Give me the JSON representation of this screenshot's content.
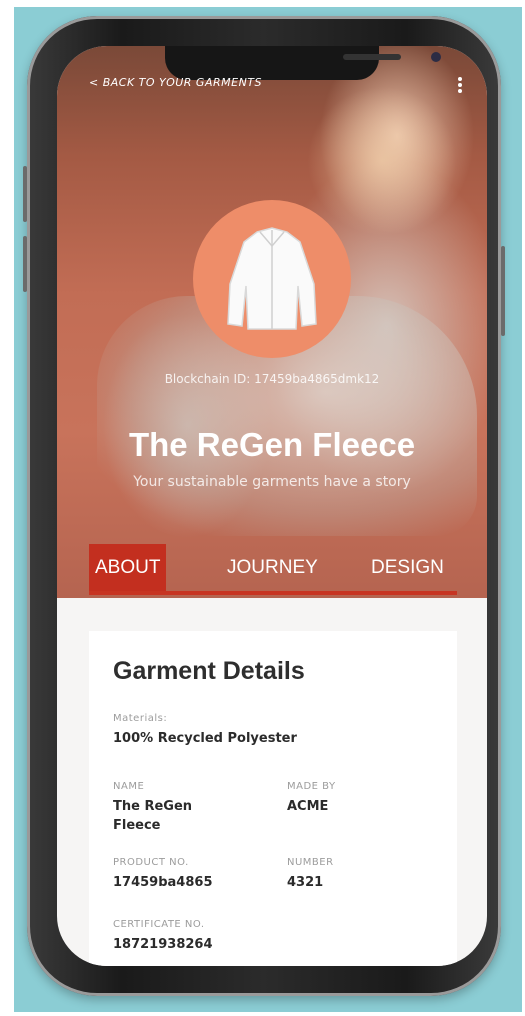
{
  "header": {
    "back_label": "Back to your garments",
    "back_chevron": "<"
  },
  "product": {
    "blockchain_id": "Blockchain ID: 17459ba4865dmk12",
    "title": "The ReGen Fleece",
    "subtitle": "Your sustainable garments have a story"
  },
  "tabs": [
    {
      "label": "ABOUT",
      "active": true
    },
    {
      "label": "JOURNEY",
      "active": false
    },
    {
      "label": "DESIGN",
      "active": false
    }
  ],
  "details": {
    "heading": "Garment Details",
    "materials_label": "Materials:",
    "materials_value": "100% Recycled Polyester",
    "name_label": "NAME",
    "name_value": "The ReGen Fleece",
    "made_by_label": "MADE BY",
    "made_by_value": "ACME",
    "product_no_label": "PRODUCT NO.",
    "product_no_value": "17459ba4865",
    "number_label": "NUMBER",
    "number_value": "4321",
    "certificate_label": "CERTIFICATE NO.",
    "certificate_value": "18721938264"
  },
  "colors": {
    "background_frame": "#8bcdd4",
    "accent_tab": "#c32f1f",
    "product_circle": "#ee8d69"
  },
  "icons": {
    "menu": "kebab-menu-icon",
    "back": "chevron-left-icon",
    "product": "jacket-icon"
  }
}
